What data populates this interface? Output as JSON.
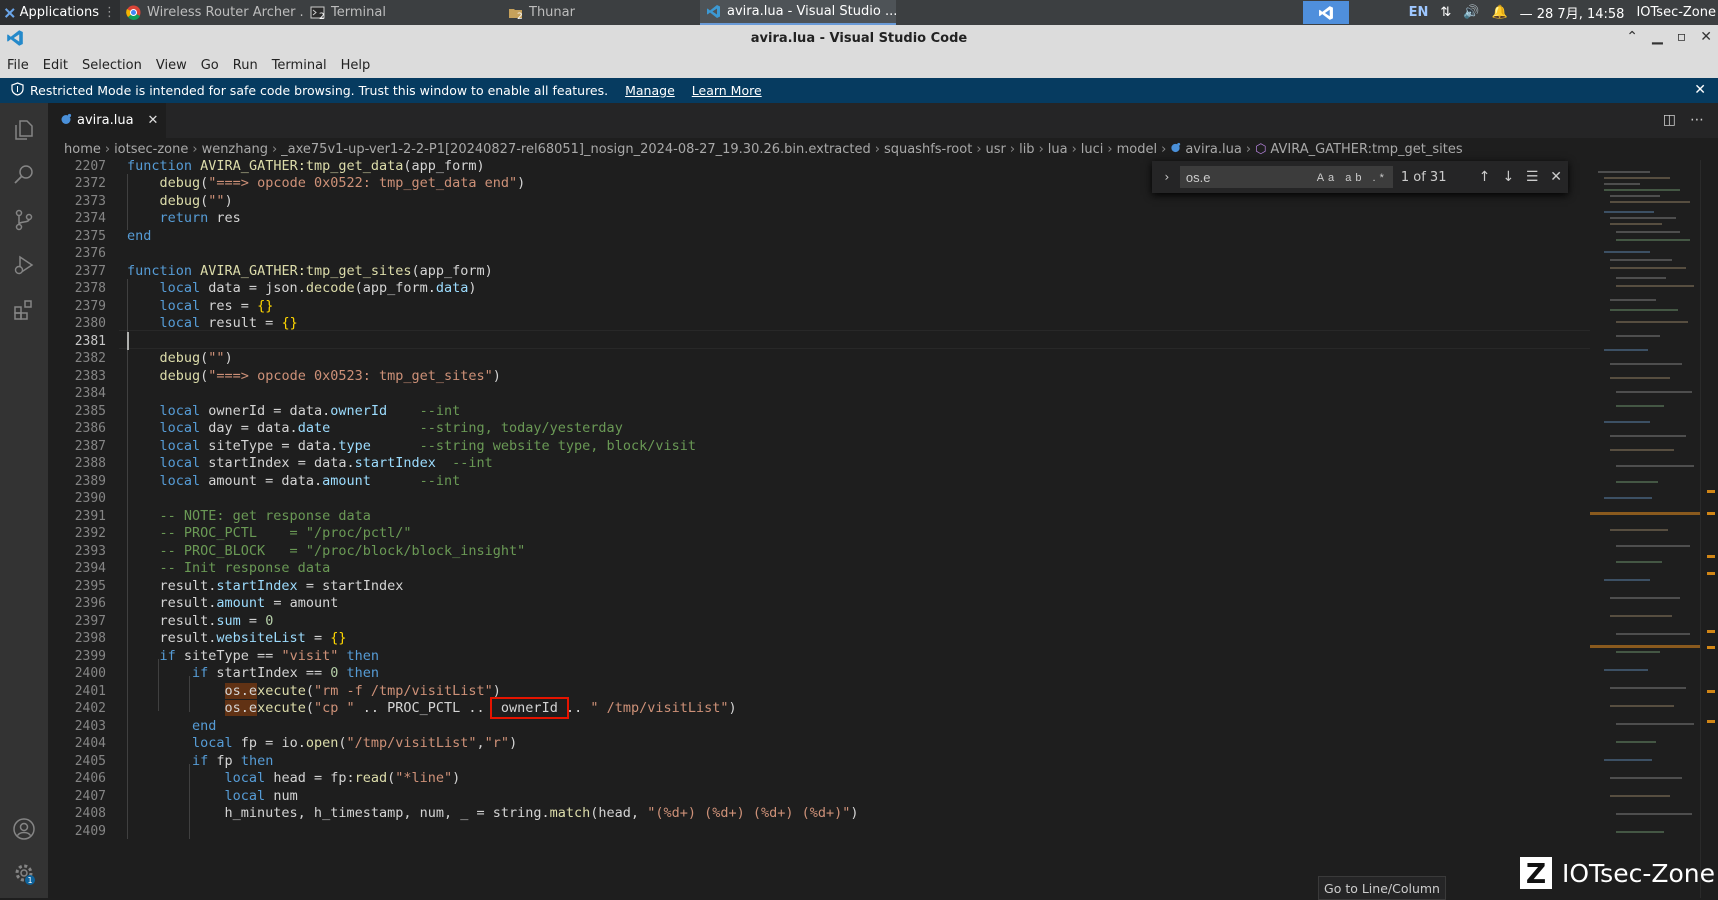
{
  "taskbar": {
    "apps_label": "Applications",
    "tasks": [
      {
        "label": "Wireless Router Archer ...",
        "icon": "chrome-icon"
      },
      {
        "label": "Terminal",
        "icon": "terminal-icon",
        "count": "2"
      },
      {
        "label": "Thunar",
        "icon": "folder-icon",
        "count": "2"
      },
      {
        "label": "avira.lua - Visual Studio ...",
        "icon": "vscode-icon"
      }
    ],
    "lang": "EN",
    "clock": "— 28 7月, 14:58",
    "user": "IOTsec-Zone"
  },
  "window": {
    "title": "avira.lua - Visual Studio Code"
  },
  "menu": [
    "File",
    "Edit",
    "Selection",
    "View",
    "Go",
    "Run",
    "Terminal",
    "Help"
  ],
  "banner": {
    "text": "Restricted Mode is intended for safe code browsing. Trust this window to enable all features.",
    "manage": "Manage",
    "learn_more": "Learn More"
  },
  "tab": {
    "filename": "avira.lua"
  },
  "breadcrumb": [
    "home",
    "iotsec-zone",
    "wenzhang",
    "_axe75v1-up-ver1-2-2-P1[20240827-rel68051]_nosign_2024-08-27_19.30.26.bin.extracted",
    "squashfs-root",
    "usr",
    "lib",
    "lua",
    "luci",
    "model",
    "avira.lua",
    "AVIRA_GATHER:tmp_get_sites"
  ],
  "find": {
    "query": "os.e",
    "count": "1 of 31",
    "options": "Aa ab .*"
  },
  "editor": {
    "sticky_line_number": "2207",
    "line_numbers": [
      "2372",
      "2373",
      "2374",
      "2375",
      "2376",
      "2377",
      "2378",
      "2379",
      "2380",
      "2381",
      "2382",
      "2383",
      "2384",
      "2385",
      "2386",
      "2387",
      "2388",
      "2389",
      "2390",
      "2391",
      "2392",
      "2393",
      "2394",
      "2395",
      "2396",
      "2397",
      "2398",
      "2399",
      "2400",
      "2401",
      "2402",
      "2403",
      "2404",
      "2405",
      "2406",
      "2407",
      "2408",
      "2409"
    ],
    "current_line": "2381"
  },
  "goto_widget": "Go to Line/Column",
  "watermark": "IOTsec-Zone",
  "colors": {
    "banner_bg": "#063b60",
    "keyword": "#569cd6",
    "string": "#ce9178",
    "comment": "#6a9955",
    "property": "#9cdcfe",
    "function": "#dcdcaa",
    "highlight_box": "#e51400"
  }
}
